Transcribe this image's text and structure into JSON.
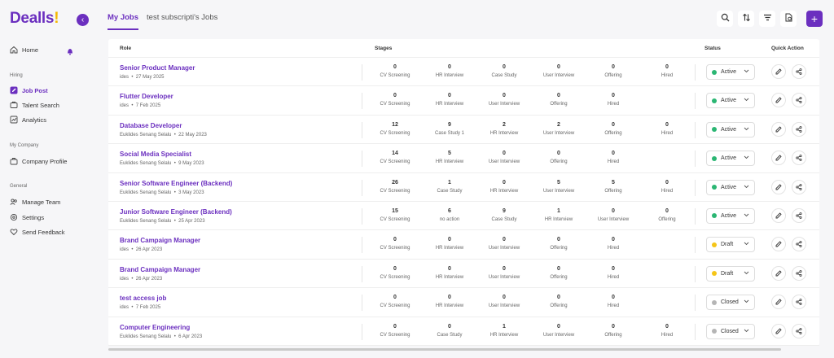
{
  "app": {
    "logo_text": "Dealls",
    "logo_bang": "!",
    "brand_color": "#6b2fbf",
    "accent_color": "#f5b800"
  },
  "sidebar": {
    "home": "Home",
    "sections": {
      "hiring": "Hiring",
      "company": "My Company",
      "general": "General"
    },
    "items": {
      "job_post": "Job Post",
      "talent_search": "Talent Search",
      "analytics": "Analytics",
      "company_profile": "Company Profile",
      "manage_team": "Manage Team",
      "settings": "Settings",
      "send_feedback": "Send Feedback"
    }
  },
  "tabs": [
    "My Jobs",
    "test subscripti's Jobs"
  ],
  "table": {
    "headers": {
      "role": "Role",
      "stages": "Stages",
      "status": "Status",
      "quick_action": "Quick Action"
    },
    "rows": [
      {
        "title": "Senior Product Manager",
        "owner": "ides",
        "date": "27 May 2025",
        "status": "Active",
        "stages": [
          [
            "0",
            "CV Screening"
          ],
          [
            "0",
            "HR Interview"
          ],
          [
            "0",
            "Case Study"
          ],
          [
            "0",
            "User Interview"
          ],
          [
            "0",
            "Offering"
          ],
          [
            "0",
            "Hired"
          ]
        ]
      },
      {
        "title": "Flutter Developer",
        "owner": "ides",
        "date": "7 Feb 2025",
        "status": "Active",
        "stages": [
          [
            "0",
            "CV Screening"
          ],
          [
            "0",
            "HR Interview"
          ],
          [
            "0",
            "User Interview"
          ],
          [
            "0",
            "Offering"
          ],
          [
            "0",
            "Hired"
          ]
        ]
      },
      {
        "title": "Database Developer",
        "owner": "Euklides Senang Selalu",
        "date": "22 May 2023",
        "status": "Active",
        "stages": [
          [
            "12",
            "CV Screening"
          ],
          [
            "9",
            "Case Study 1"
          ],
          [
            "2",
            "HR Interview"
          ],
          [
            "2",
            "User Interview"
          ],
          [
            "0",
            "Offering"
          ],
          [
            "0",
            "Hired"
          ]
        ]
      },
      {
        "title": "Social Media Specialist",
        "owner": "Euklides Senang Selalu",
        "date": "9 May 2023",
        "status": "Active",
        "stages": [
          [
            "14",
            "CV Screening"
          ],
          [
            "5",
            "HR Interview"
          ],
          [
            "0",
            "User Interview"
          ],
          [
            "0",
            "Offering"
          ],
          [
            "0",
            "Hired"
          ]
        ]
      },
      {
        "title": "Senior Software Engineer (Backend)",
        "owner": "Euklides Senang Selalu",
        "date": "3 May 2023",
        "status": "Active",
        "stages": [
          [
            "26",
            "CV Screening"
          ],
          [
            "1",
            "Case Study"
          ],
          [
            "0",
            "HR Interview"
          ],
          [
            "5",
            "User Interview"
          ],
          [
            "5",
            "Offering"
          ],
          [
            "0",
            "Hired"
          ]
        ]
      },
      {
        "title": "Junior Software Engineer (Backend)",
        "owner": "Euklides Senang Selalu",
        "date": "25 Apr 2023",
        "status": "Active",
        "stages": [
          [
            "15",
            "CV Screening"
          ],
          [
            "6",
            "no action"
          ],
          [
            "9",
            "Case Study"
          ],
          [
            "1",
            "HR Interview"
          ],
          [
            "0",
            "User Interview"
          ],
          [
            "0",
            "Offering"
          ]
        ]
      },
      {
        "title": "Brand Campaign Manager",
        "owner": "ides",
        "date": "26 Apr 2023",
        "status": "Draft",
        "stages": [
          [
            "0",
            "CV Screening"
          ],
          [
            "0",
            "HR Interview"
          ],
          [
            "0",
            "User Interview"
          ],
          [
            "0",
            "Offering"
          ],
          [
            "0",
            "Hired"
          ]
        ]
      },
      {
        "title": "Brand Campaign Manager",
        "owner": "ides",
        "date": "26 Apr 2023",
        "status": "Draft",
        "stages": [
          [
            "0",
            "CV Screening"
          ],
          [
            "0",
            "HR Interview"
          ],
          [
            "0",
            "User Interview"
          ],
          [
            "0",
            "Offering"
          ],
          [
            "0",
            "Hired"
          ]
        ]
      },
      {
        "title": "test access job",
        "owner": "ides",
        "date": "7 Feb 2025",
        "status": "Closed",
        "stages": [
          [
            "0",
            "CV Screening"
          ],
          [
            "0",
            "HR Interview"
          ],
          [
            "0",
            "User Interview"
          ],
          [
            "0",
            "Offering"
          ],
          [
            "0",
            "Hired"
          ]
        ]
      },
      {
        "title": "Computer Engineering",
        "owner": "Euklides Senang Selalu",
        "date": "6 Apr 2023",
        "status": "Closed",
        "stages": [
          [
            "0",
            "CV Screening"
          ],
          [
            "0",
            "Case Study"
          ],
          [
            "1",
            "HR Interview"
          ],
          [
            "0",
            "User Interview"
          ],
          [
            "0",
            "Offering"
          ],
          [
            "0",
            "Hired"
          ]
        ]
      }
    ]
  },
  "status_colors": {
    "Active": "#2bb673",
    "Draft": "#f5c518",
    "Closed": "#b5b5b5"
  },
  "icons": {
    "toolbar": [
      "search-icon",
      "sort-icon",
      "filter-icon",
      "report-icon",
      "plus-icon"
    ],
    "row_actions": [
      "edit-icon",
      "share-icon"
    ]
  }
}
